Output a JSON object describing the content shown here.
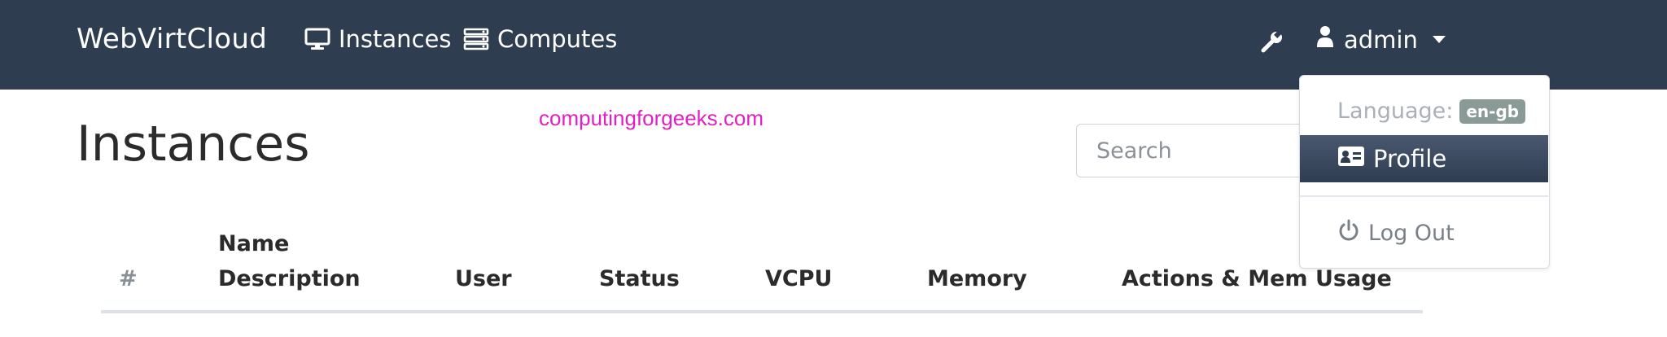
{
  "navbar": {
    "brand": "WebVirtCloud",
    "links": [
      {
        "label": "Instances",
        "icon": "desktop-icon"
      },
      {
        "label": "Computes",
        "icon": "server-icon"
      }
    ],
    "settings_icon": "wrench-icon",
    "user": {
      "label": "admin",
      "icon": "user-icon"
    }
  },
  "page": {
    "title": "Instances",
    "watermark": "computingforgeeks.com",
    "search": {
      "placeholder": "Search",
      "value": ""
    }
  },
  "table": {
    "columns": [
      {
        "label": "#"
      },
      {
        "label": "Name",
        "sublabel": "Description"
      },
      {
        "label": "User"
      },
      {
        "label": "Status"
      },
      {
        "label": "VCPU"
      },
      {
        "label": "Memory"
      },
      {
        "label": "Actions & Mem Usage"
      }
    ]
  },
  "dropdown": {
    "language_label": "Language:",
    "language_value": "en-gb",
    "profile_label": "Profile",
    "logout_label": "Log Out"
  },
  "colors": {
    "navbar_bg": "#2f3d51",
    "watermark": "#e020c4",
    "badge_bg": "#8a9a96"
  }
}
